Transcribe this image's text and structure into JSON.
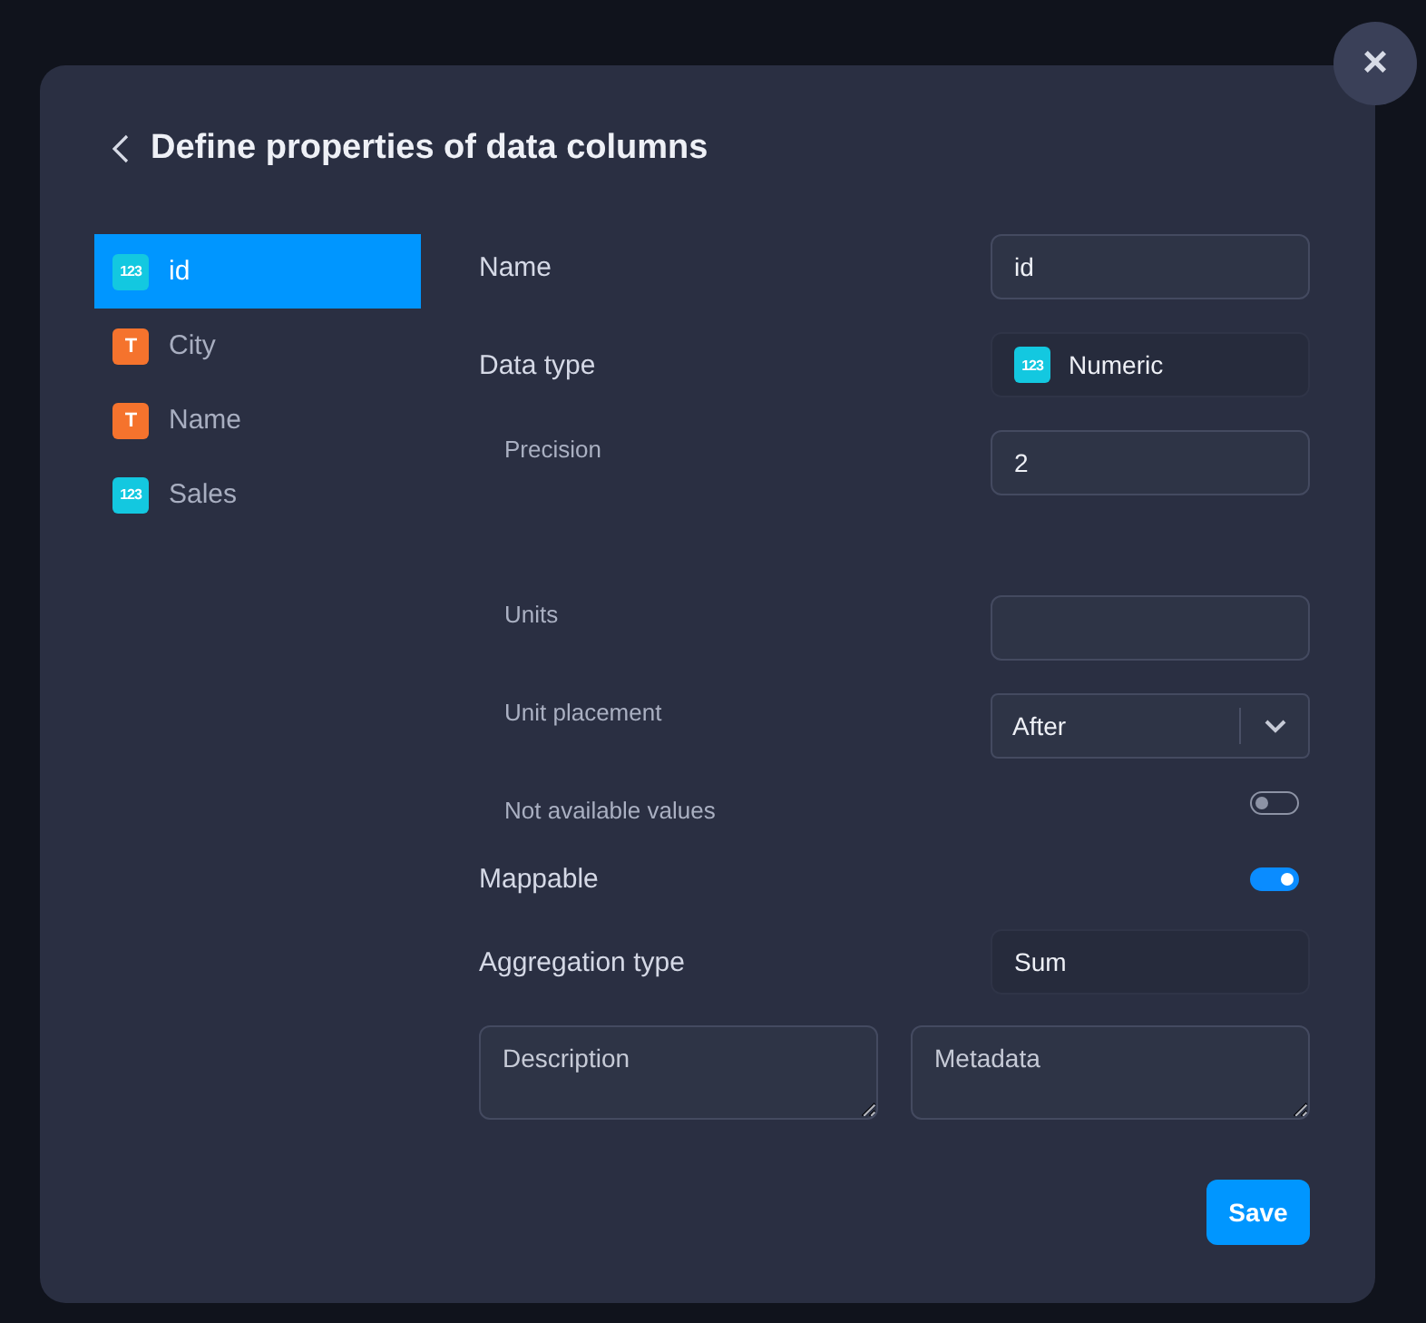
{
  "dialog": {
    "title": "Define properties of data columns",
    "close_glyph": "×"
  },
  "columns": [
    {
      "label": "id",
      "kind": "numeric",
      "glyph": "123",
      "selected": true
    },
    {
      "label": "City",
      "kind": "text",
      "glyph": "T",
      "selected": false
    },
    {
      "label": "Name",
      "kind": "text",
      "glyph": "T",
      "selected": false
    },
    {
      "label": "Sales",
      "kind": "numeric",
      "glyph": "123",
      "selected": false
    }
  ],
  "fields": [
    {
      "kind": "input",
      "label": "Name",
      "value": "id"
    },
    {
      "kind": "type",
      "label": "Data type",
      "value": "Numeric",
      "glyph": "123",
      "children": [
        {
          "kind": "input",
          "label": "Precision",
          "value": "2"
        },
        {
          "kind": "input",
          "label": "Units"
        },
        {
          "kind": "select",
          "label": "Unit placement",
          "value": "After"
        },
        {
          "kind": "toggle",
          "label": "Not available values",
          "on": false
        }
      ]
    },
    {
      "kind": "toggle",
      "label": "Mappable",
      "on": true
    },
    {
      "kind": "display",
      "label": "Aggregation type",
      "value": "Sum"
    }
  ],
  "text_areas": [
    {
      "placeholder": "Description"
    },
    {
      "placeholder": "Metadata"
    }
  ],
  "save_button": "Save"
}
